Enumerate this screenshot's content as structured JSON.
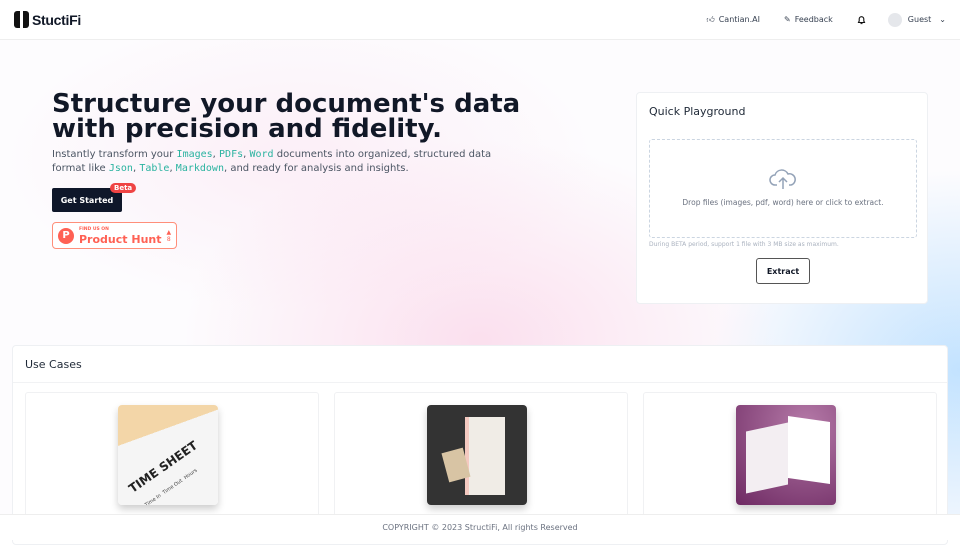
{
  "header": {
    "logo_text": "StuctiFi",
    "nav": [
      {
        "label": "Cantian.AI",
        "icon": "thumbs-up-icon"
      },
      {
        "label": "Feedback",
        "icon": "pencil-icon"
      }
    ],
    "user": "Guest"
  },
  "hero": {
    "title": "Structure your document's data with precision and fidelity.",
    "sub_prefix": "Instantly transform your ",
    "sub_images": "Images",
    "sub_pdfs": "PDFs",
    "sub_word": "Word",
    "sub_mid": " documents into organized, structured data format like ",
    "sub_json": "Json",
    "sub_table": "Table",
    "sub_markdown": "Markdown",
    "sub_suffix": ", and ready for analysis and insights.",
    "comma": ", ",
    "cta": "Get Started",
    "badge": "Beta",
    "product_hunt": {
      "small": "FIND US ON",
      "big": "Product Hunt",
      "votes": "8"
    }
  },
  "playground": {
    "title": "Quick Playground",
    "drop_text": "Drop files (images, pdf, word) here or click to extract.",
    "note": "During BETA period, support 1 file with 3 MB size as maximum.",
    "button": "Extract"
  },
  "use_cases": {
    "title": "Use Cases",
    "timesheet": {
      "title": "TIME SHEET",
      "columns": [
        "Time In",
        "Time Out",
        "Hours"
      ]
    }
  },
  "footer": "COPYRIGHT © 2023 StructiFi, All rights Reserved",
  "colors": {
    "accent_code": "#2bb3a0",
    "cta": "#0f172a",
    "badge": "#ef4444",
    "product_hunt": "#ff6154"
  }
}
